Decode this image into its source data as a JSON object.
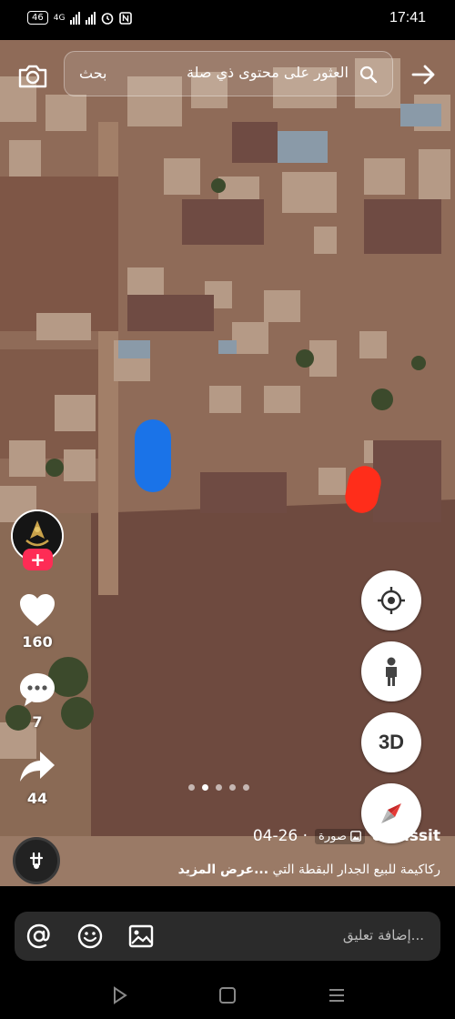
{
  "status_bar": {
    "network_badge": "46",
    "time": "17:41",
    "icons": [
      "volte-icon",
      "signal-icon",
      "signal-icon",
      "alarm-icon",
      "nfc-icon"
    ]
  },
  "search": {
    "button_label": "بحث",
    "placeholder": "العثور على محتوى ذي صلة"
  },
  "actions": {
    "likes": "160",
    "comments": "7",
    "shares": "44"
  },
  "map_controls": {
    "three_d_label": "3D"
  },
  "carousel": {
    "count": 5,
    "active_index": 1
  },
  "caption": {
    "author": "elhassit",
    "tag": "صورة",
    "date": "04-26 ·",
    "text": "ركاكيمة للبيع الجدار البقطة التي",
    "more": "...عرض المزيد"
  },
  "comment": {
    "placeholder": "...إضافة تعليق"
  },
  "colors": {
    "follow": "#fe2c55",
    "blue_mark": "#1a73e8",
    "red_mark": "#ff2d1a"
  }
}
